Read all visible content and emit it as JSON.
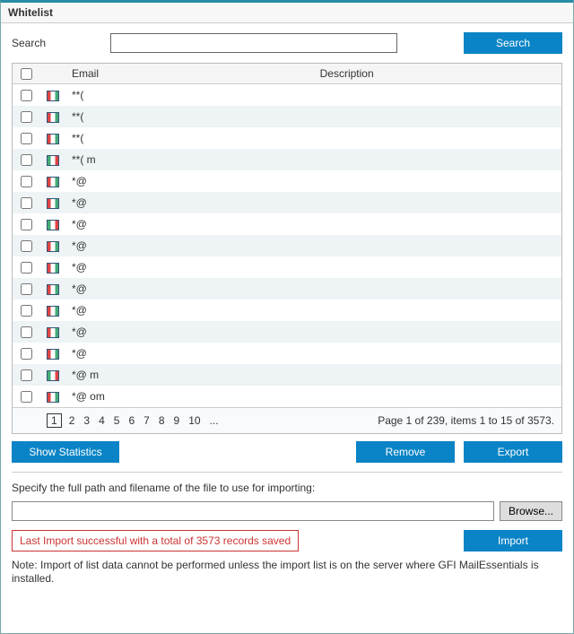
{
  "window": {
    "title": "Whitelist"
  },
  "search": {
    "label": "Search",
    "value": "",
    "button": "Search"
  },
  "columns": {
    "email": "Email",
    "description": "Description"
  },
  "rows": [
    {
      "icon": "red",
      "email": "**(",
      "desc": ""
    },
    {
      "icon": "red",
      "email": "**(",
      "desc": ""
    },
    {
      "icon": "red",
      "email": "**(",
      "desc": ""
    },
    {
      "icon": "green",
      "email": "**(            m",
      "desc": ""
    },
    {
      "icon": "red",
      "email": "*@",
      "desc": ""
    },
    {
      "icon": "red",
      "email": "*@",
      "desc": ""
    },
    {
      "icon": "green",
      "email": "*@",
      "desc": ""
    },
    {
      "icon": "red",
      "email": "*@",
      "desc": ""
    },
    {
      "icon": "red",
      "email": "*@",
      "desc": ""
    },
    {
      "icon": "red",
      "email": "*@",
      "desc": ""
    },
    {
      "icon": "red",
      "email": "*@",
      "desc": ""
    },
    {
      "icon": "red",
      "email": "*@",
      "desc": ""
    },
    {
      "icon": "red",
      "email": "*@",
      "desc": ""
    },
    {
      "icon": "green",
      "email": "*@             m",
      "desc": ""
    },
    {
      "icon": "red",
      "email": "*@            om",
      "desc": ""
    }
  ],
  "pager": {
    "pages": [
      "1",
      "2",
      "3",
      "4",
      "5",
      "6",
      "7",
      "8",
      "9",
      "10",
      "..."
    ],
    "current": "1",
    "summary": "Page 1 of 239, items 1 to 15 of 3573."
  },
  "buttons": {
    "stats": "Show Statistics",
    "remove": "Remove",
    "export": "Export"
  },
  "import": {
    "label": "Specify the full path and filename of the file to use for importing:",
    "path": "",
    "browse": "Browse...",
    "status": "Last Import successful with a total of 3573 records saved",
    "button": "Import",
    "note": "Note: Import of list data cannot be performed unless the import list is on the server where GFI MailEssentials is installed."
  }
}
